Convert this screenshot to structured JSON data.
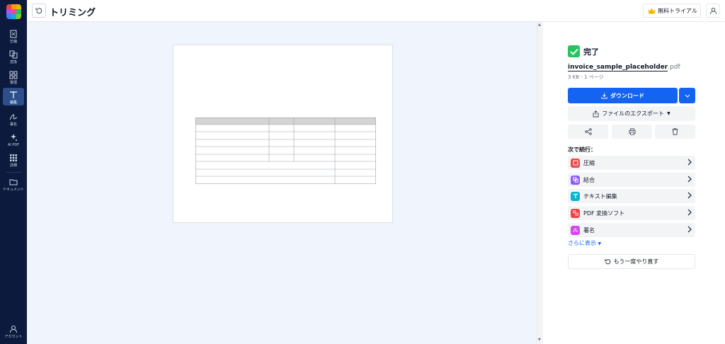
{
  "app": {
    "title": "トリミング"
  },
  "sidebar": {
    "items": [
      {
        "label": "圧縮",
        "icon": "compress-icon"
      },
      {
        "label": "変換",
        "icon": "convert-icon"
      },
      {
        "label": "整理",
        "icon": "organize-icon"
      },
      {
        "label": "編集",
        "icon": "edit-icon"
      },
      {
        "label": "署名",
        "icon": "sign-icon"
      },
      {
        "label": "AI PDF",
        "icon": "ai-sparkle-icon"
      },
      {
        "label": "詳細",
        "icon": "grid-icon"
      },
      {
        "label": "ドキュメント",
        "icon": "folder-icon"
      }
    ],
    "account_label": "アカウント"
  },
  "header": {
    "trial_label": "無料トライアル"
  },
  "result": {
    "status": "完了",
    "file_name": "invoice_sample_placeholder",
    "file_ext": ".pdf",
    "file_meta": "3 KB - 1 ページ",
    "download_label": "ダウンロード",
    "export_label": "ファイルのエクスポート",
    "next_label": "次で続行：",
    "tools": [
      {
        "label": "圧縮",
        "color": "#ef4444"
      },
      {
        "label": "結合",
        "color": "#8b5cf6"
      },
      {
        "label": "テキスト編集",
        "color": "#06b6d4"
      },
      {
        "label": "PDF 変換ソフト",
        "color": "#ef4444"
      },
      {
        "label": "署名",
        "color": "#d946ef"
      }
    ],
    "more_label": "さらに表示",
    "retry_label": "もう一度やり直す"
  },
  "colors": {
    "accent": "#1463f3",
    "sidebar_bg": "#0b1a3d",
    "success": "#22c55e"
  }
}
